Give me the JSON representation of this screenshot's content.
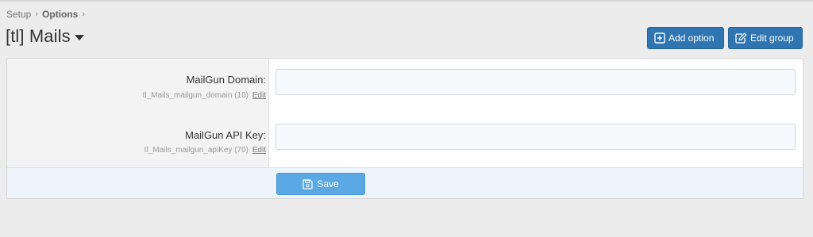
{
  "breadcrumb": {
    "items": [
      {
        "label": "Setup"
      },
      {
        "label": "Options"
      }
    ],
    "separator": "›"
  },
  "header": {
    "title": "[tl] Mails",
    "caret_icon": "caret-down-icon"
  },
  "toolbar": {
    "add_option_label": "Add option",
    "add_option_icon": "plus-square-icon",
    "edit_group_label": "Edit group",
    "edit_group_icon": "edit-square-icon",
    "accent_color": "#2e75b2"
  },
  "options": [
    {
      "label": "MailGun Domain:",
      "key": "tl_Mails_mailgun_domain (10)",
      "edit_label": "Edit",
      "value": ""
    },
    {
      "label": "MailGun API Key:",
      "key": "tl_Mails_mailgun_apiKey (70)",
      "edit_label": "Edit",
      "value": ""
    }
  ],
  "footer": {
    "save_label": "Save",
    "save_icon": "floppy-disk-icon",
    "save_color": "#5aa8e4"
  }
}
